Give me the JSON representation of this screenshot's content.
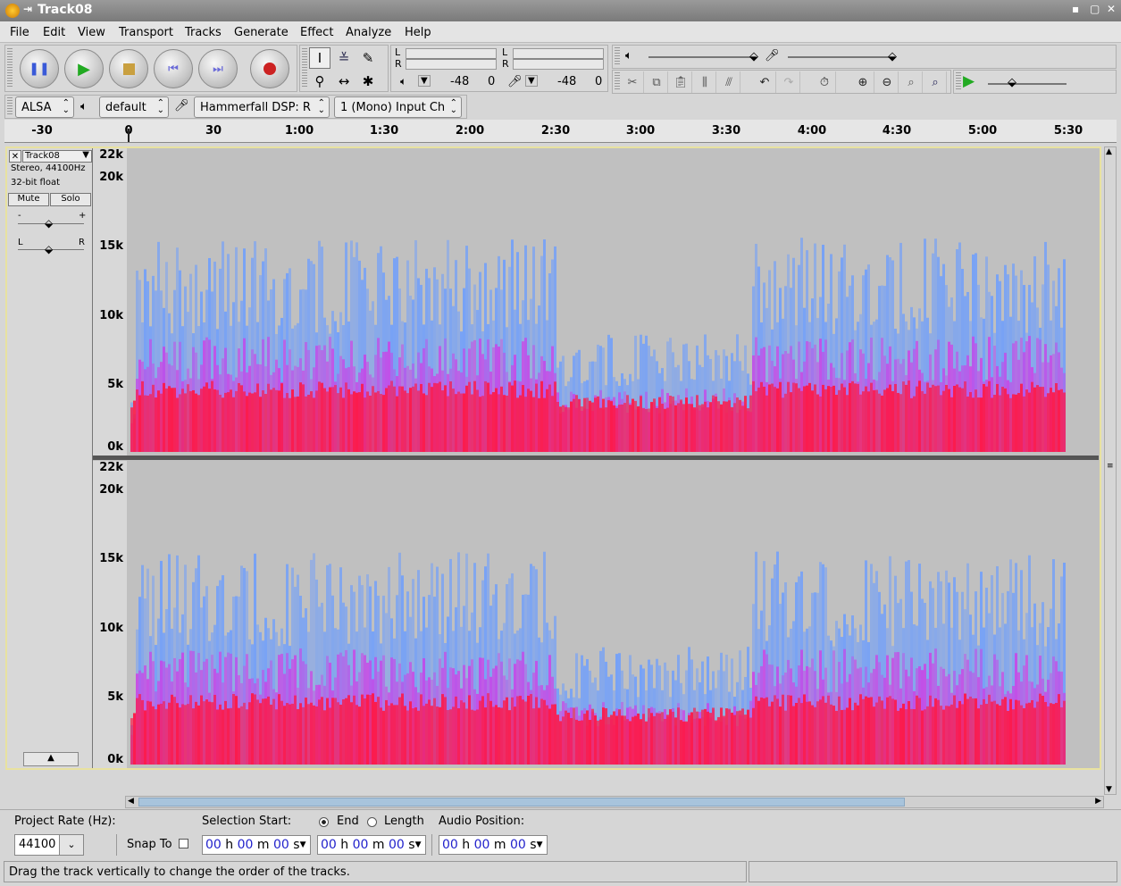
{
  "window": {
    "title": "Track08"
  },
  "menu": [
    {
      "label": "File"
    },
    {
      "label": "Edit"
    },
    {
      "label": "View"
    },
    {
      "label": "Transport"
    },
    {
      "label": "Tracks"
    },
    {
      "label": "Generate"
    },
    {
      "label": "Effect"
    },
    {
      "label": "Analyze"
    },
    {
      "label": "Help"
    }
  ],
  "meters": {
    "play_l": "L",
    "play_r": "R",
    "rec_l": "L",
    "rec_r": "R",
    "play_db": "-48",
    "play_zero": "0",
    "rec_db": "-48",
    "rec_zero": "0"
  },
  "device": {
    "host": "ALSA",
    "output": "default",
    "input": "Hammerfall DSP: R",
    "channels": "1 (Mono) Input Ch"
  },
  "timeline": {
    "ticks": [
      "-30",
      "0",
      "30",
      "1:00",
      "1:30",
      "2:00",
      "2:30",
      "3:00",
      "3:30",
      "4:00",
      "4:30",
      "5:00",
      "5:30"
    ]
  },
  "track": {
    "name": "Track08",
    "format": "Stereo, 44100Hz",
    "bits": "32-bit float",
    "mute": "Mute",
    "solo": "Solo",
    "gain_minus": "-",
    "gain_plus": "+",
    "pan_left": "L",
    "pan_right": "R",
    "freq_labels": [
      "22k",
      "20k",
      "15k",
      "10k",
      "5k",
      "0k"
    ]
  },
  "bottom": {
    "project_rate_label": "Project Rate (Hz):",
    "project_rate": "44100",
    "snap_to": "Snap To",
    "selection_start_label": "Selection Start:",
    "end_label": "End",
    "length_label": "Length",
    "audio_position_label": "Audio Position:",
    "time_hh": "00",
    "time_h": "h",
    "time_mm": "00",
    "time_m": "m",
    "time_ss": "00",
    "time_s": "s"
  },
  "status": {
    "text": "Drag the track vertically to change the order of the tracks."
  },
  "colors": {
    "spectrum_low": "#ff1744",
    "spectrum_mid": "#d633e6",
    "spectrum_high": "#6a9cff",
    "background": "#c0c0c0"
  }
}
